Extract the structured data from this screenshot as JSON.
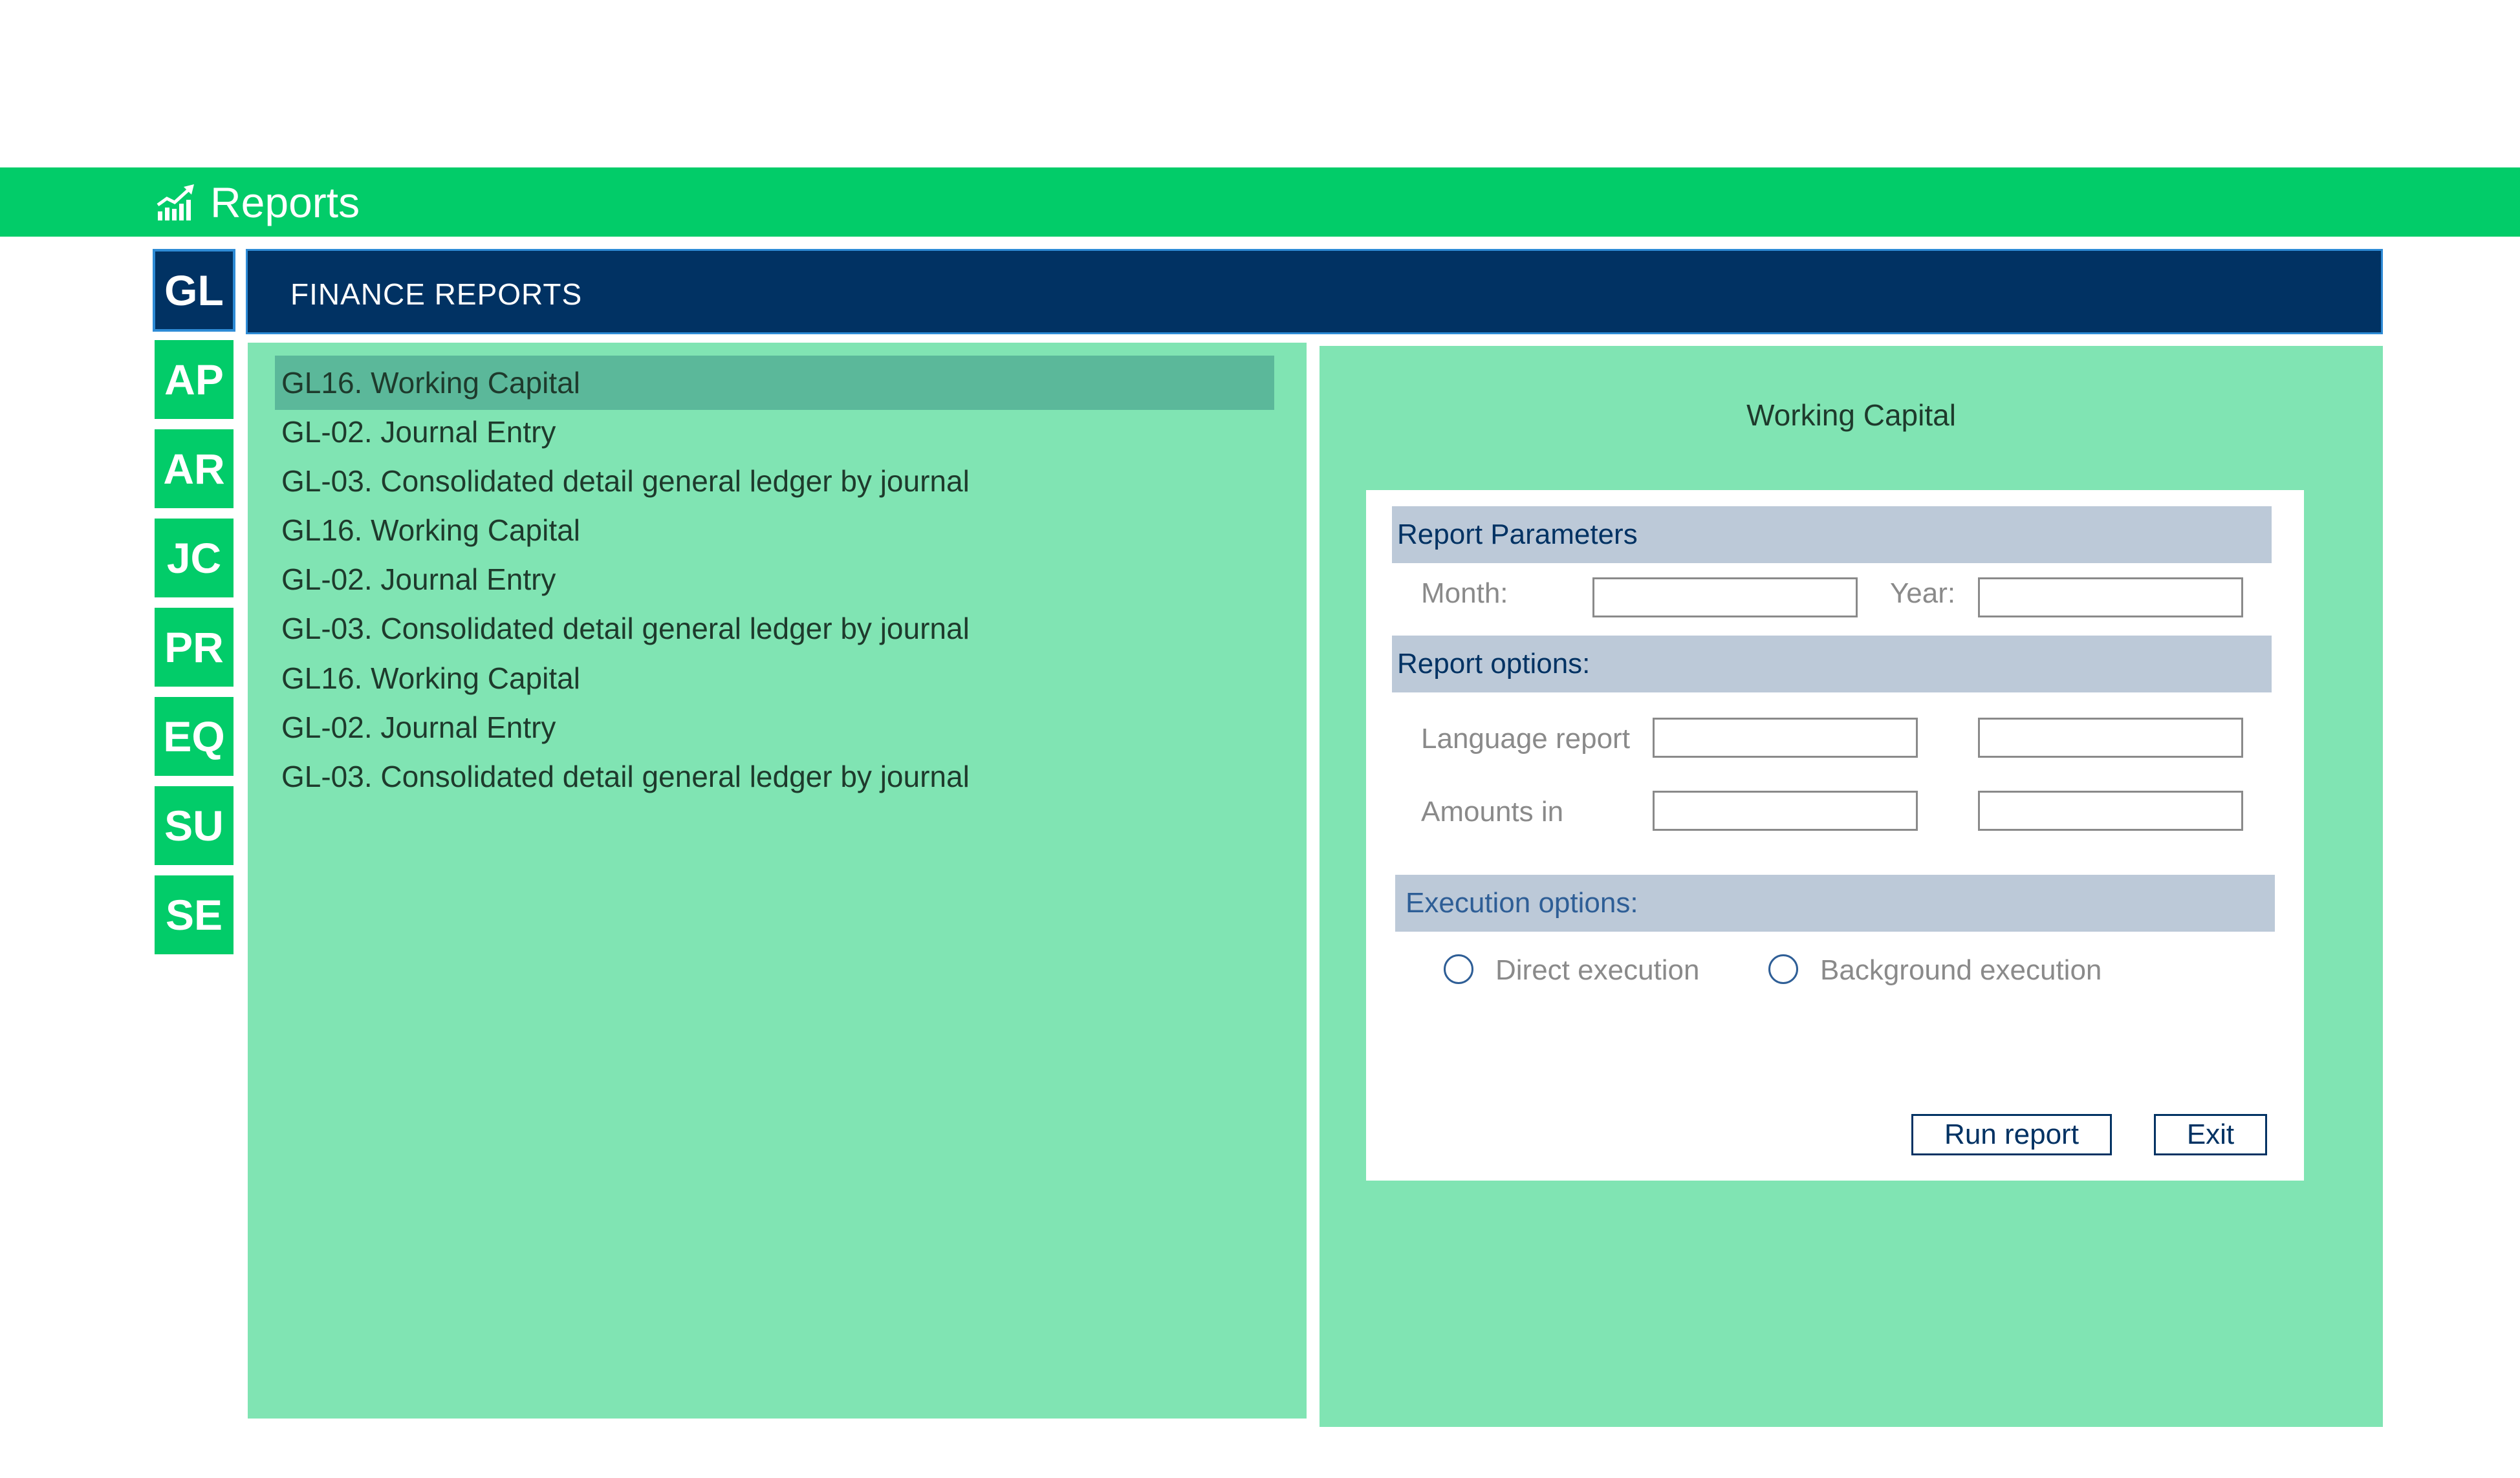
{
  "app": {
    "title": "Reports",
    "icon": "chart-trend-icon"
  },
  "modules": [
    {
      "code": "GL",
      "active": true
    },
    {
      "code": "AP",
      "active": false
    },
    {
      "code": "AR",
      "active": false
    },
    {
      "code": "JC",
      "active": false
    },
    {
      "code": "PR",
      "active": false
    },
    {
      "code": "EQ",
      "active": false
    },
    {
      "code": "SU",
      "active": false
    },
    {
      "code": "SE",
      "active": false
    }
  ],
  "section": {
    "title": "FINANCE REPORTS"
  },
  "reports": [
    {
      "label": "GL16. Working Capital",
      "selected": true
    },
    {
      "label": "GL-02. Journal Entry",
      "selected": false
    },
    {
      "label": "GL-03. Consolidated detail general ledger by journal",
      "selected": false
    },
    {
      "label": "GL16. Working Capital",
      "selected": false
    },
    {
      "label": "GL-02. Journal Entry",
      "selected": false
    },
    {
      "label": "GL-03. Consolidated detail general ledger by journal",
      "selected": false
    },
    {
      "label": "GL16. Working Capital",
      "selected": false
    },
    {
      "label": "GL-02. Journal Entry",
      "selected": false
    },
    {
      "label": "GL-03. Consolidated detail general ledger by journal",
      "selected": false
    }
  ],
  "detail": {
    "title": "Working Capital",
    "parameters": {
      "heading": "Report Parameters",
      "month_label": "Month:",
      "month_value": "",
      "year_label": "Year:",
      "year_value": ""
    },
    "options": {
      "heading": "Report options:",
      "language_label": "Language report",
      "language_value": "",
      "language_value_2": "",
      "amounts_label": "Amounts in",
      "amounts_value": "",
      "amounts_value_2": ""
    },
    "execution": {
      "heading": "Execution options:",
      "direct_label": "Direct execution",
      "direct_selected": false,
      "background_label": "Background execution",
      "background_selected": false
    },
    "buttons": {
      "run": "Run report",
      "exit": "Exit"
    }
  },
  "colors": {
    "accent_green": "#02cc69",
    "panel_green": "#80e4b3",
    "selected_row": "#5bb89a",
    "navy": "#013263",
    "band_gray": "#bcc9d8"
  }
}
